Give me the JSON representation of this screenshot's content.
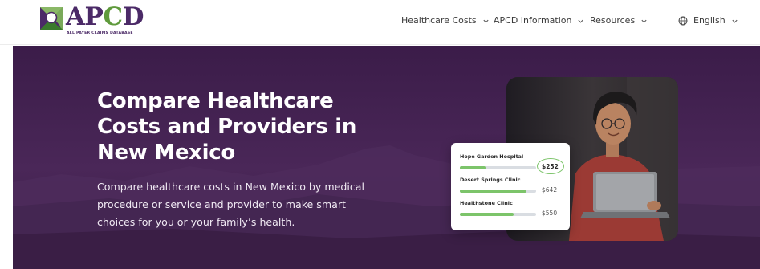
{
  "header": {
    "logo": {
      "name": "APCD",
      "tagline": "ALL PAYER CLAIMS DATABASE"
    },
    "nav": [
      {
        "label": "Healthcare Costs",
        "icon": "chevron-down-icon"
      },
      {
        "label": "APCD Information",
        "icon": "chevron-down-icon"
      },
      {
        "label": "Resources",
        "icon": "chevron-down-icon"
      }
    ],
    "language": {
      "label": "English",
      "icon": "globe-icon"
    }
  },
  "hero": {
    "title": "Compare Healthcare Costs and Providers in New Mexico",
    "description": "Compare healthcare costs in New Mexico by medical procedure or service and provider to make smart choices for you or your family’s health.",
    "price_card": {
      "items": [
        {
          "name": "Hope Garden Hospital",
          "price": "$252",
          "fill": 0.34,
          "highlight": true
        },
        {
          "name": "Desert Springs Clinic",
          "price": "$642",
          "fill": 0.87,
          "highlight": false
        },
        {
          "name": "Healthstone Clinic",
          "price": "$550",
          "fill": 0.7,
          "highlight": false
        }
      ]
    }
  },
  "colors": {
    "brand_purple": "#4b2a67",
    "brand_green": "#5f9a3c",
    "hero_bg": "#3f1f4c",
    "bar_fill": "#7cc46a"
  }
}
